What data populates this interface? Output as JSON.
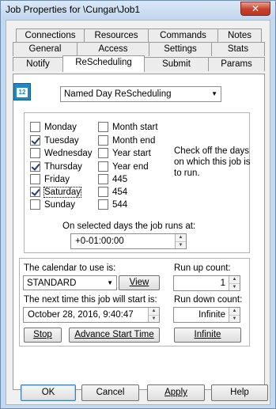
{
  "window": {
    "title": "Job Properties for \\Cungar\\Job1",
    "close_glyph": "✕"
  },
  "tabs": {
    "row1": [
      "Connections",
      "Resources",
      "Commands",
      "Notes"
    ],
    "row2": [
      "General",
      "Access",
      "Settings",
      "Stats"
    ],
    "row3": [
      "Notify",
      "ReScheduling",
      "Submit",
      "Params"
    ]
  },
  "active_tab": "ReScheduling",
  "calendar_icon": {
    "text": "12",
    "color": "#1e88c8"
  },
  "schedule_type": {
    "selected": "Named Day ReScheduling"
  },
  "days": [
    {
      "label": "Monday",
      "checked": false
    },
    {
      "label": "Tuesday",
      "checked": true
    },
    {
      "label": "Wednesday",
      "checked": false
    },
    {
      "label": "Thursday",
      "checked": true
    },
    {
      "label": "Friday",
      "checked": false
    },
    {
      "label": "Saturday",
      "checked": true
    },
    {
      "label": "Sunday",
      "checked": false
    }
  ],
  "periods": [
    {
      "label": "Month start",
      "checked": false
    },
    {
      "label": "Month end",
      "checked": false
    },
    {
      "label": "Year start",
      "checked": false
    },
    {
      "label": "Year end",
      "checked": false
    },
    {
      "label": "445",
      "checked": false
    },
    {
      "label": "454",
      "checked": false
    },
    {
      "label": "544",
      "checked": false
    }
  ],
  "hint": [
    "Check off the days",
    "on which this job is",
    "to run."
  ],
  "runs_at": {
    "label": "On selected days the job runs at:",
    "value": "+0-01:00:00"
  },
  "calendar": {
    "label": "The calendar to use is:",
    "value": "STANDARD",
    "view_label": "View"
  },
  "next_start": {
    "label": "The next time this job will start is:",
    "value": "October 28, 2016,  9:40:47"
  },
  "run_up": {
    "label": "Run up count:",
    "value": "1"
  },
  "run_down": {
    "label": "Run down count:",
    "value": "Infinite"
  },
  "buttons": {
    "stop": "Stop",
    "advance": "Advance Start Time",
    "infinite": "Infinite",
    "ok": "OK",
    "cancel": "Cancel",
    "apply": "Apply",
    "help": "Help"
  }
}
